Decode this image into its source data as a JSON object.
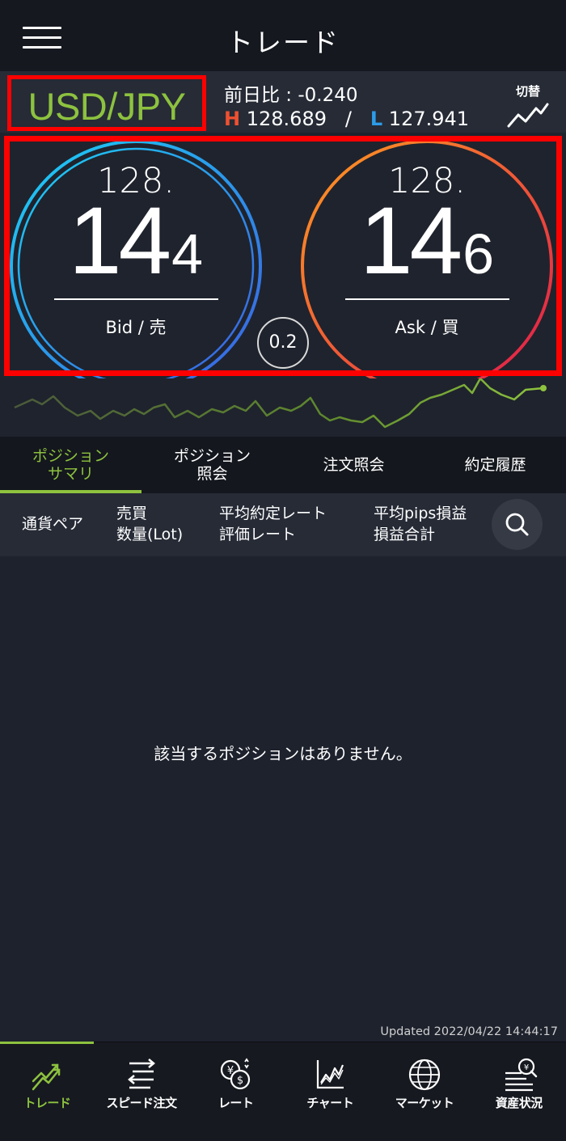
{
  "header": {
    "title": "トレード"
  },
  "quote": {
    "pair": "USD/JPY",
    "change_label": "前日比",
    "change_value": "-0.240",
    "high_letter": "H",
    "high_value": "128.689",
    "separator": "/",
    "low_letter": "L",
    "low_value": "127.941",
    "toggle_label": "切替"
  },
  "bid": {
    "top": "128.",
    "main": "14",
    "pip": "4",
    "label": "Bid / 売",
    "color_start": "#1ad0f5",
    "color_end": "#3c5ee0"
  },
  "ask": {
    "top": "128.",
    "main": "14",
    "pip": "6",
    "label": "Ask / 買",
    "color_start": "#ff9a20",
    "color_end": "#e0184c"
  },
  "spread": "0.2",
  "tabs": [
    {
      "label": "ポジション\nサマリ",
      "active": true
    },
    {
      "label": "ポジション\n照会",
      "active": false
    },
    {
      "label": "注文照会",
      "active": false
    },
    {
      "label": "約定履歴",
      "active": false
    }
  ],
  "columns": {
    "pair": "通貨ペア",
    "side": "売買",
    "qty": "数量(Lot)",
    "avg_rate": "平均約定レート",
    "eval_rate": "評価レート",
    "avg_pips": "平均pips損益",
    "pl_total": "損益合計"
  },
  "empty_message": "該当するポジションはありません。",
  "updated": "Updated  2022/04/22 14:44:17",
  "nav": [
    {
      "label": "トレード",
      "icon": "trade-icon",
      "active": true
    },
    {
      "label": "スピード注文",
      "icon": "speed-order-icon",
      "active": false
    },
    {
      "label": "レート",
      "icon": "rate-icon",
      "active": false
    },
    {
      "label": "チャート",
      "icon": "chart-icon",
      "active": false
    },
    {
      "label": "マーケット",
      "icon": "market-icon",
      "active": false
    },
    {
      "label": "資産状況",
      "icon": "assets-icon",
      "active": false
    }
  ],
  "colors": {
    "accent": "#8dc23f",
    "highlight_box": "#ff0000",
    "background": "#1e222d"
  }
}
